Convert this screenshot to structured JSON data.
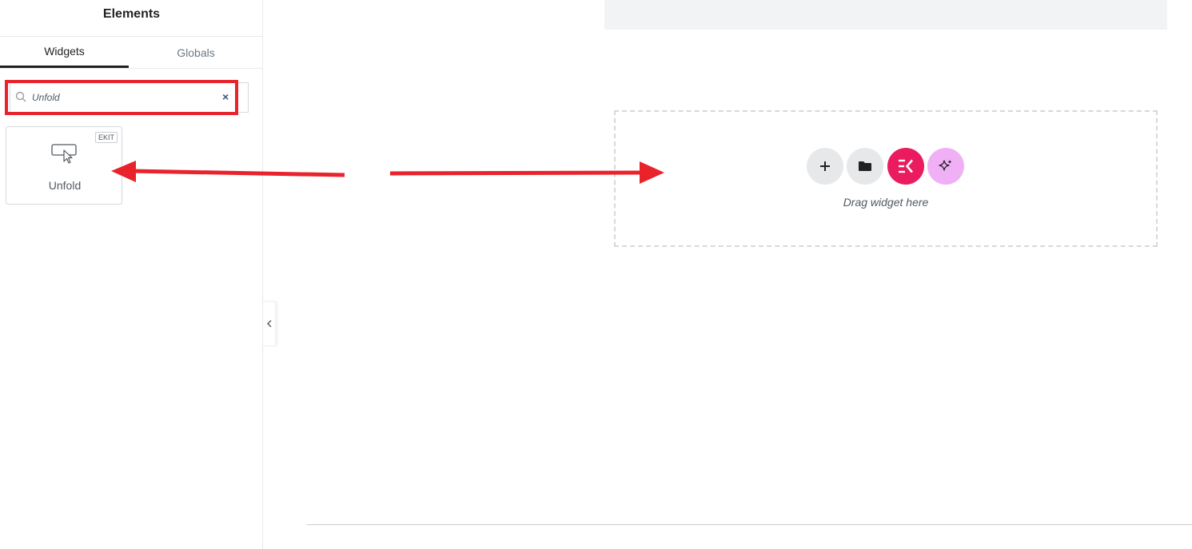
{
  "sidebar": {
    "title": "Elements",
    "tabs": [
      {
        "label": "Widgets",
        "active": true
      },
      {
        "label": "Globals",
        "active": false
      }
    ],
    "search": {
      "value": "Unfold",
      "placeholder": "Search Widget...",
      "clear_symbol": "×"
    },
    "widgets": [
      {
        "label": "Unfold",
        "badge": "EKIT",
        "icon": "mouse-pointer-box-icon"
      }
    ]
  },
  "canvas": {
    "drop_zone_text": "Drag widget here",
    "buttons": [
      {
        "name": "add-section-button",
        "icon": "plus-icon"
      },
      {
        "name": "template-library-button",
        "icon": "folder-icon"
      },
      {
        "name": "elementskit-button",
        "icon": "ekit-logo-icon"
      },
      {
        "name": "ai-button",
        "icon": "sparkle-icon"
      }
    ]
  },
  "colors": {
    "accent_red": "#e8232b",
    "ekit_pink": "#ea1b5f",
    "ai_purple": "#f0b0f5"
  }
}
